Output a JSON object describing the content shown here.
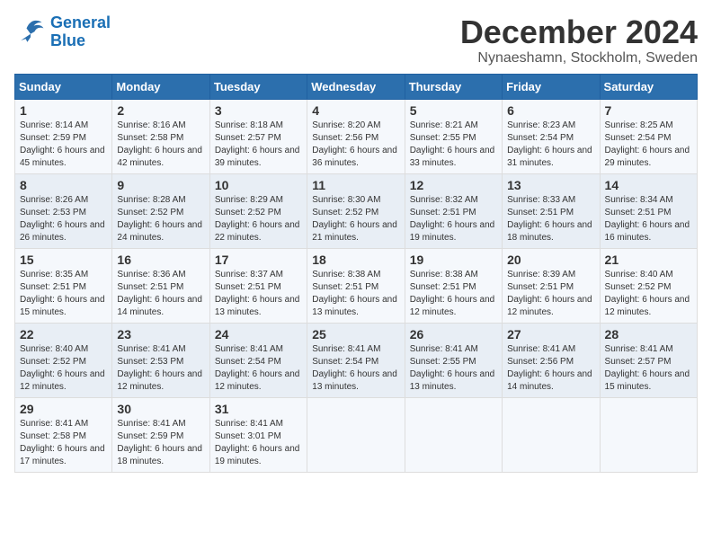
{
  "logo": {
    "line1": "General",
    "line2": "Blue"
  },
  "title": "December 2024",
  "subtitle": "Nynaeshamn, Stockholm, Sweden",
  "weekdays": [
    "Sunday",
    "Monday",
    "Tuesday",
    "Wednesday",
    "Thursday",
    "Friday",
    "Saturday"
  ],
  "weeks": [
    [
      {
        "day": "1",
        "sunrise": "8:14 AM",
        "sunset": "2:59 PM",
        "daylight": "6 hours and 45 minutes."
      },
      {
        "day": "2",
        "sunrise": "8:16 AM",
        "sunset": "2:58 PM",
        "daylight": "6 hours and 42 minutes."
      },
      {
        "day": "3",
        "sunrise": "8:18 AM",
        "sunset": "2:57 PM",
        "daylight": "6 hours and 39 minutes."
      },
      {
        "day": "4",
        "sunrise": "8:20 AM",
        "sunset": "2:56 PM",
        "daylight": "6 hours and 36 minutes."
      },
      {
        "day": "5",
        "sunrise": "8:21 AM",
        "sunset": "2:55 PM",
        "daylight": "6 hours and 33 minutes."
      },
      {
        "day": "6",
        "sunrise": "8:23 AM",
        "sunset": "2:54 PM",
        "daylight": "6 hours and 31 minutes."
      },
      {
        "day": "7",
        "sunrise": "8:25 AM",
        "sunset": "2:54 PM",
        "daylight": "6 hours and 29 minutes."
      }
    ],
    [
      {
        "day": "8",
        "sunrise": "8:26 AM",
        "sunset": "2:53 PM",
        "daylight": "6 hours and 26 minutes."
      },
      {
        "day": "9",
        "sunrise": "8:28 AM",
        "sunset": "2:52 PM",
        "daylight": "6 hours and 24 minutes."
      },
      {
        "day": "10",
        "sunrise": "8:29 AM",
        "sunset": "2:52 PM",
        "daylight": "6 hours and 22 minutes."
      },
      {
        "day": "11",
        "sunrise": "8:30 AM",
        "sunset": "2:52 PM",
        "daylight": "6 hours and 21 minutes."
      },
      {
        "day": "12",
        "sunrise": "8:32 AM",
        "sunset": "2:51 PM",
        "daylight": "6 hours and 19 minutes."
      },
      {
        "day": "13",
        "sunrise": "8:33 AM",
        "sunset": "2:51 PM",
        "daylight": "6 hours and 18 minutes."
      },
      {
        "day": "14",
        "sunrise": "8:34 AM",
        "sunset": "2:51 PM",
        "daylight": "6 hours and 16 minutes."
      }
    ],
    [
      {
        "day": "15",
        "sunrise": "8:35 AM",
        "sunset": "2:51 PM",
        "daylight": "6 hours and 15 minutes."
      },
      {
        "day": "16",
        "sunrise": "8:36 AM",
        "sunset": "2:51 PM",
        "daylight": "6 hours and 14 minutes."
      },
      {
        "day": "17",
        "sunrise": "8:37 AM",
        "sunset": "2:51 PM",
        "daylight": "6 hours and 13 minutes."
      },
      {
        "day": "18",
        "sunrise": "8:38 AM",
        "sunset": "2:51 PM",
        "daylight": "6 hours and 13 minutes."
      },
      {
        "day": "19",
        "sunrise": "8:38 AM",
        "sunset": "2:51 PM",
        "daylight": "6 hours and 12 minutes."
      },
      {
        "day": "20",
        "sunrise": "8:39 AM",
        "sunset": "2:51 PM",
        "daylight": "6 hours and 12 minutes."
      },
      {
        "day": "21",
        "sunrise": "8:40 AM",
        "sunset": "2:52 PM",
        "daylight": "6 hours and 12 minutes."
      }
    ],
    [
      {
        "day": "22",
        "sunrise": "8:40 AM",
        "sunset": "2:52 PM",
        "daylight": "6 hours and 12 minutes."
      },
      {
        "day": "23",
        "sunrise": "8:41 AM",
        "sunset": "2:53 PM",
        "daylight": "6 hours and 12 minutes."
      },
      {
        "day": "24",
        "sunrise": "8:41 AM",
        "sunset": "2:54 PM",
        "daylight": "6 hours and 12 minutes."
      },
      {
        "day": "25",
        "sunrise": "8:41 AM",
        "sunset": "2:54 PM",
        "daylight": "6 hours and 13 minutes."
      },
      {
        "day": "26",
        "sunrise": "8:41 AM",
        "sunset": "2:55 PM",
        "daylight": "6 hours and 13 minutes."
      },
      {
        "day": "27",
        "sunrise": "8:41 AM",
        "sunset": "2:56 PM",
        "daylight": "6 hours and 14 minutes."
      },
      {
        "day": "28",
        "sunrise": "8:41 AM",
        "sunset": "2:57 PM",
        "daylight": "6 hours and 15 minutes."
      }
    ],
    [
      {
        "day": "29",
        "sunrise": "8:41 AM",
        "sunset": "2:58 PM",
        "daylight": "6 hours and 17 minutes."
      },
      {
        "day": "30",
        "sunrise": "8:41 AM",
        "sunset": "2:59 PM",
        "daylight": "6 hours and 18 minutes."
      },
      {
        "day": "31",
        "sunrise": "8:41 AM",
        "sunset": "3:01 PM",
        "daylight": "6 hours and 19 minutes."
      },
      null,
      null,
      null,
      null
    ]
  ]
}
